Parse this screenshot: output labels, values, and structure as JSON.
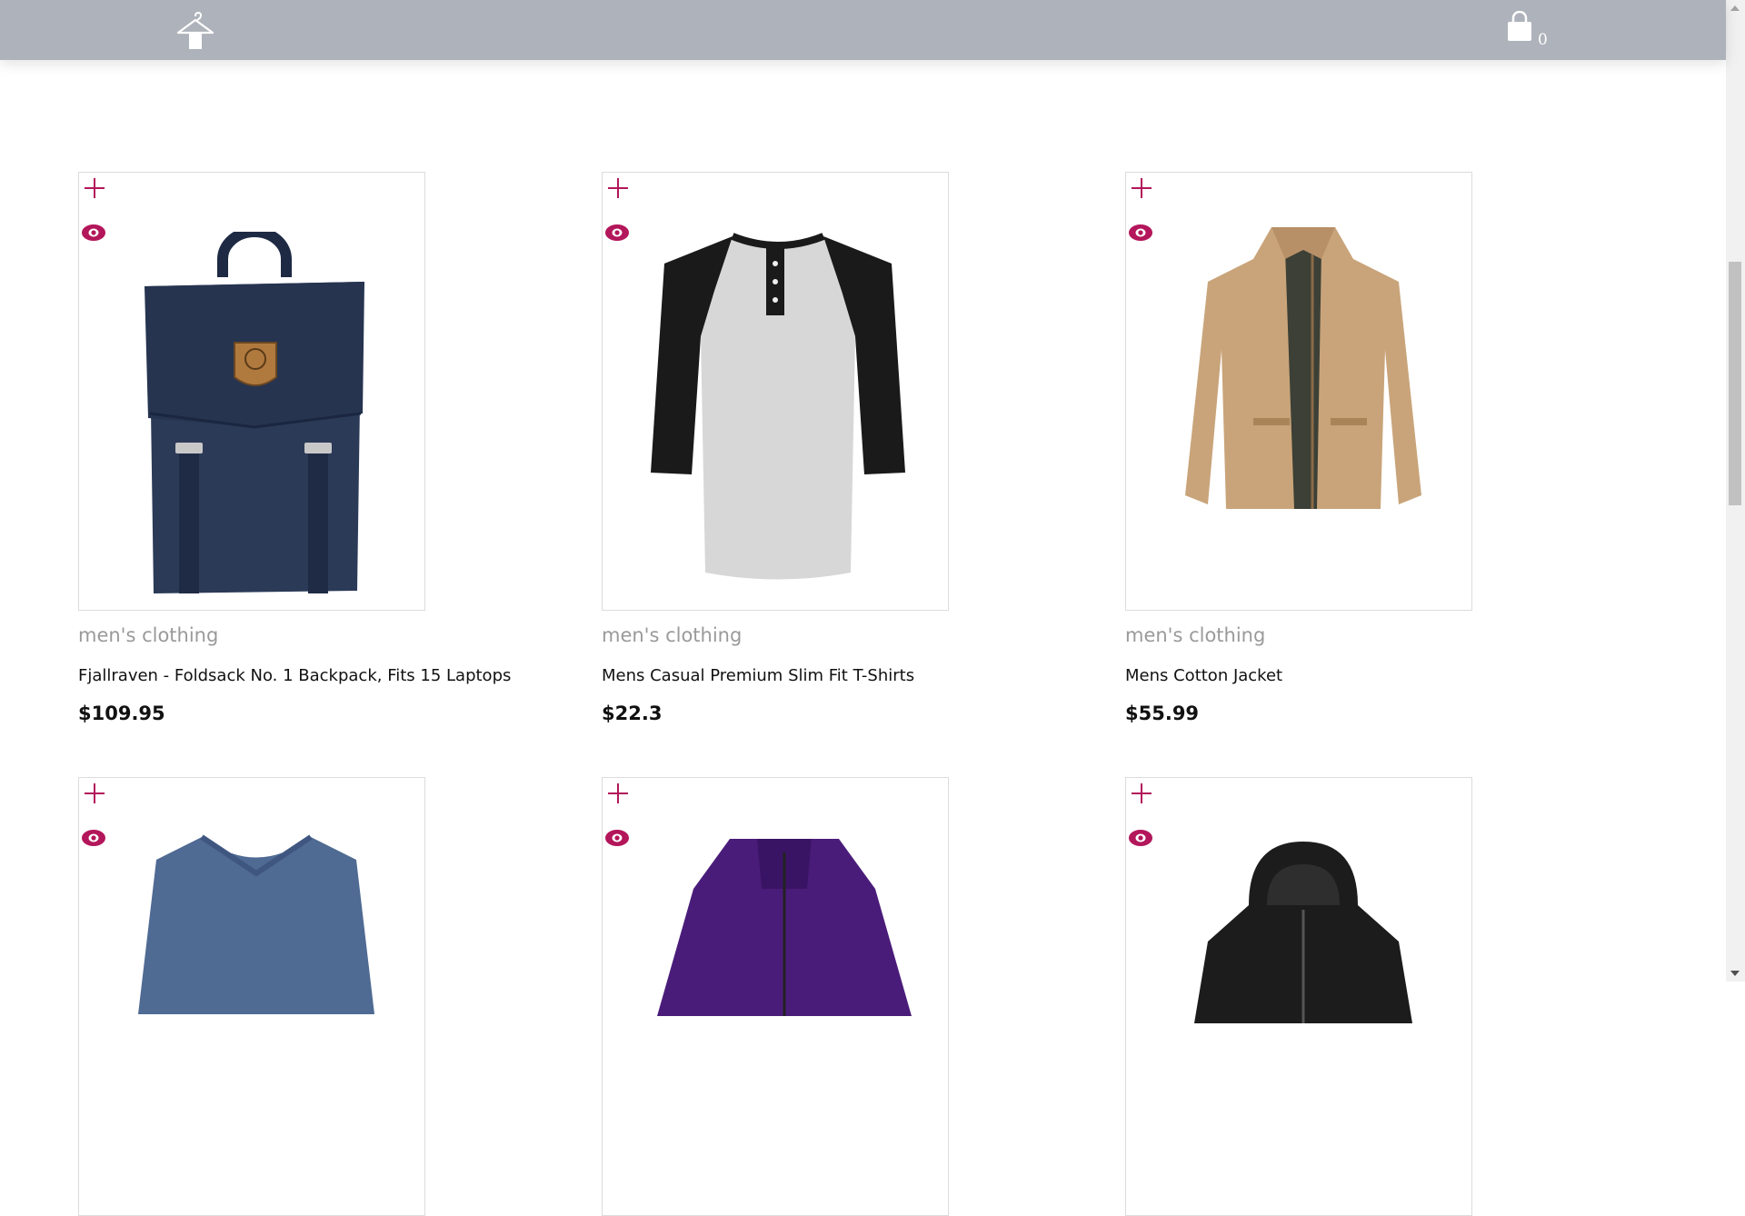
{
  "header": {
    "logo_icon": "hanger-icon",
    "cart_icon": "shopping-bag-icon",
    "cart_count": "0"
  },
  "products": [
    {
      "category": "men's clothing",
      "title": "Fjallraven - Foldsack No. 1 Backpack, Fits 15 Laptops",
      "price": "$109.95",
      "image": "navy-backpack"
    },
    {
      "category": "men's clothing",
      "title": "Mens Casual Premium Slim Fit T-Shirts",
      "price": "$22.3",
      "image": "raglan-henley-tshirt"
    },
    {
      "category": "men's clothing",
      "title": "Mens Cotton Jacket",
      "price": "$55.99",
      "image": "khaki-cotton-jacket"
    },
    {
      "image": "blue-vneck-sweater"
    },
    {
      "image": "purple-3in1-jacket"
    },
    {
      "image": "black-hooded-leather-jacket"
    }
  ],
  "colors": {
    "header_bg": "#aeb2ba",
    "accent": "#b3165a",
    "category_text": "#9a9a9a"
  }
}
